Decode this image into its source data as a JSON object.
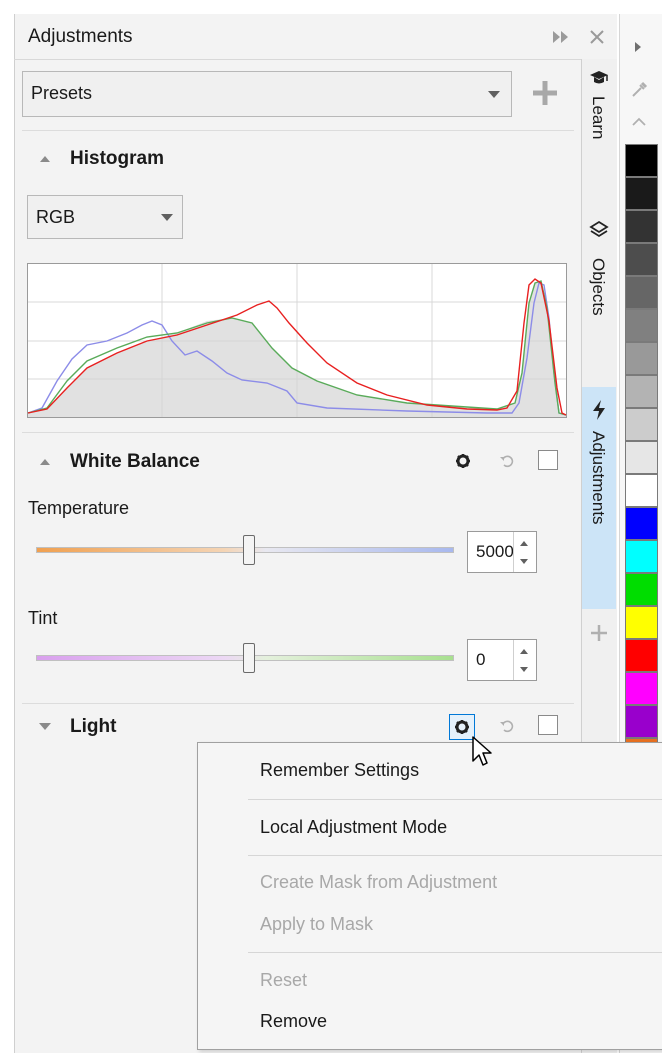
{
  "panel": {
    "title": "Adjustments",
    "presets_value": "Presets"
  },
  "histogram": {
    "title": "Histogram",
    "channel_value": "RGB"
  },
  "white_balance": {
    "title": "White Balance",
    "temperature_label": "Temperature",
    "temperature_value": "5000",
    "temperature_level": 0.51,
    "tint_label": "Tint",
    "tint_value": "0",
    "tint_level": 0.51
  },
  "light": {
    "title": "Light"
  },
  "side_tabs": [
    {
      "label": "Learn",
      "icon": "mortarboard-icon"
    },
    {
      "label": "Objects",
      "icon": "layers-icon"
    },
    {
      "label": "Adjustments",
      "icon": "lightning-icon",
      "active": true
    }
  ],
  "context_menu": {
    "items": [
      {
        "label": "Remember Settings",
        "enabled": true
      },
      {
        "label": "Local Adjustment Mode",
        "enabled": true
      },
      {
        "label": "Create Mask from Adjustment",
        "enabled": false
      },
      {
        "label": "Apply to Mask",
        "enabled": false
      },
      {
        "label": "Reset",
        "enabled": false
      },
      {
        "label": "Remove",
        "enabled": true
      }
    ]
  },
  "palette": {
    "colors": [
      "#000000",
      "#1a1a1a",
      "#333333",
      "#4d4d4d",
      "#666666",
      "#808080",
      "#999999",
      "#b3b3b3",
      "#cccccc",
      "#e6e6e6",
      "#ffffff",
      "#0000ff",
      "#00ffff",
      "#00dd00",
      "#ffff00",
      "#ff0000",
      "#ff00ff",
      "#9900cc",
      "#e87020"
    ]
  },
  "colors": {
    "accent": "#0078d7",
    "active_tab": "#cce4f7",
    "temperature_warm": "#f0a050",
    "temperature_cool": "#a8b8ee",
    "tint_magenta": "#d9a0ee",
    "tint_green": "#a8e090"
  }
}
